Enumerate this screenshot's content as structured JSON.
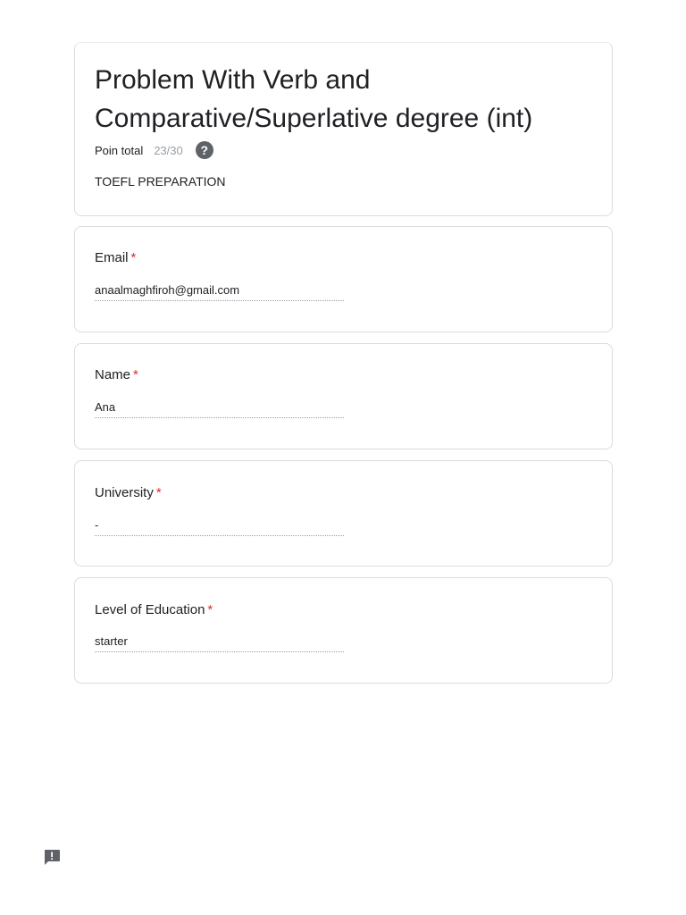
{
  "header": {
    "title": "Problem With Verb and Comparative/Superlative degree (int)",
    "points_label": "Poin total",
    "points_value": "23/30",
    "help_icon_glyph": "?",
    "description": "TOEFL PREPARATION"
  },
  "questions": [
    {
      "label": "Email",
      "required_mark": "*",
      "answer": "anaalmaghfiroh@gmail.com"
    },
    {
      "label": "Name",
      "required_mark": "*",
      "answer": "Ana"
    },
    {
      "label": "University",
      "required_mark": "*",
      "answer": "-"
    },
    {
      "label": "Level of Education",
      "required_mark": "*",
      "answer": "starter"
    }
  ],
  "icons": {
    "help": "help-circle-icon",
    "feedback": "report-feedback-icon"
  },
  "colors": {
    "required": "#d93025",
    "icon": "#5f6368",
    "border": "#dadce0"
  }
}
